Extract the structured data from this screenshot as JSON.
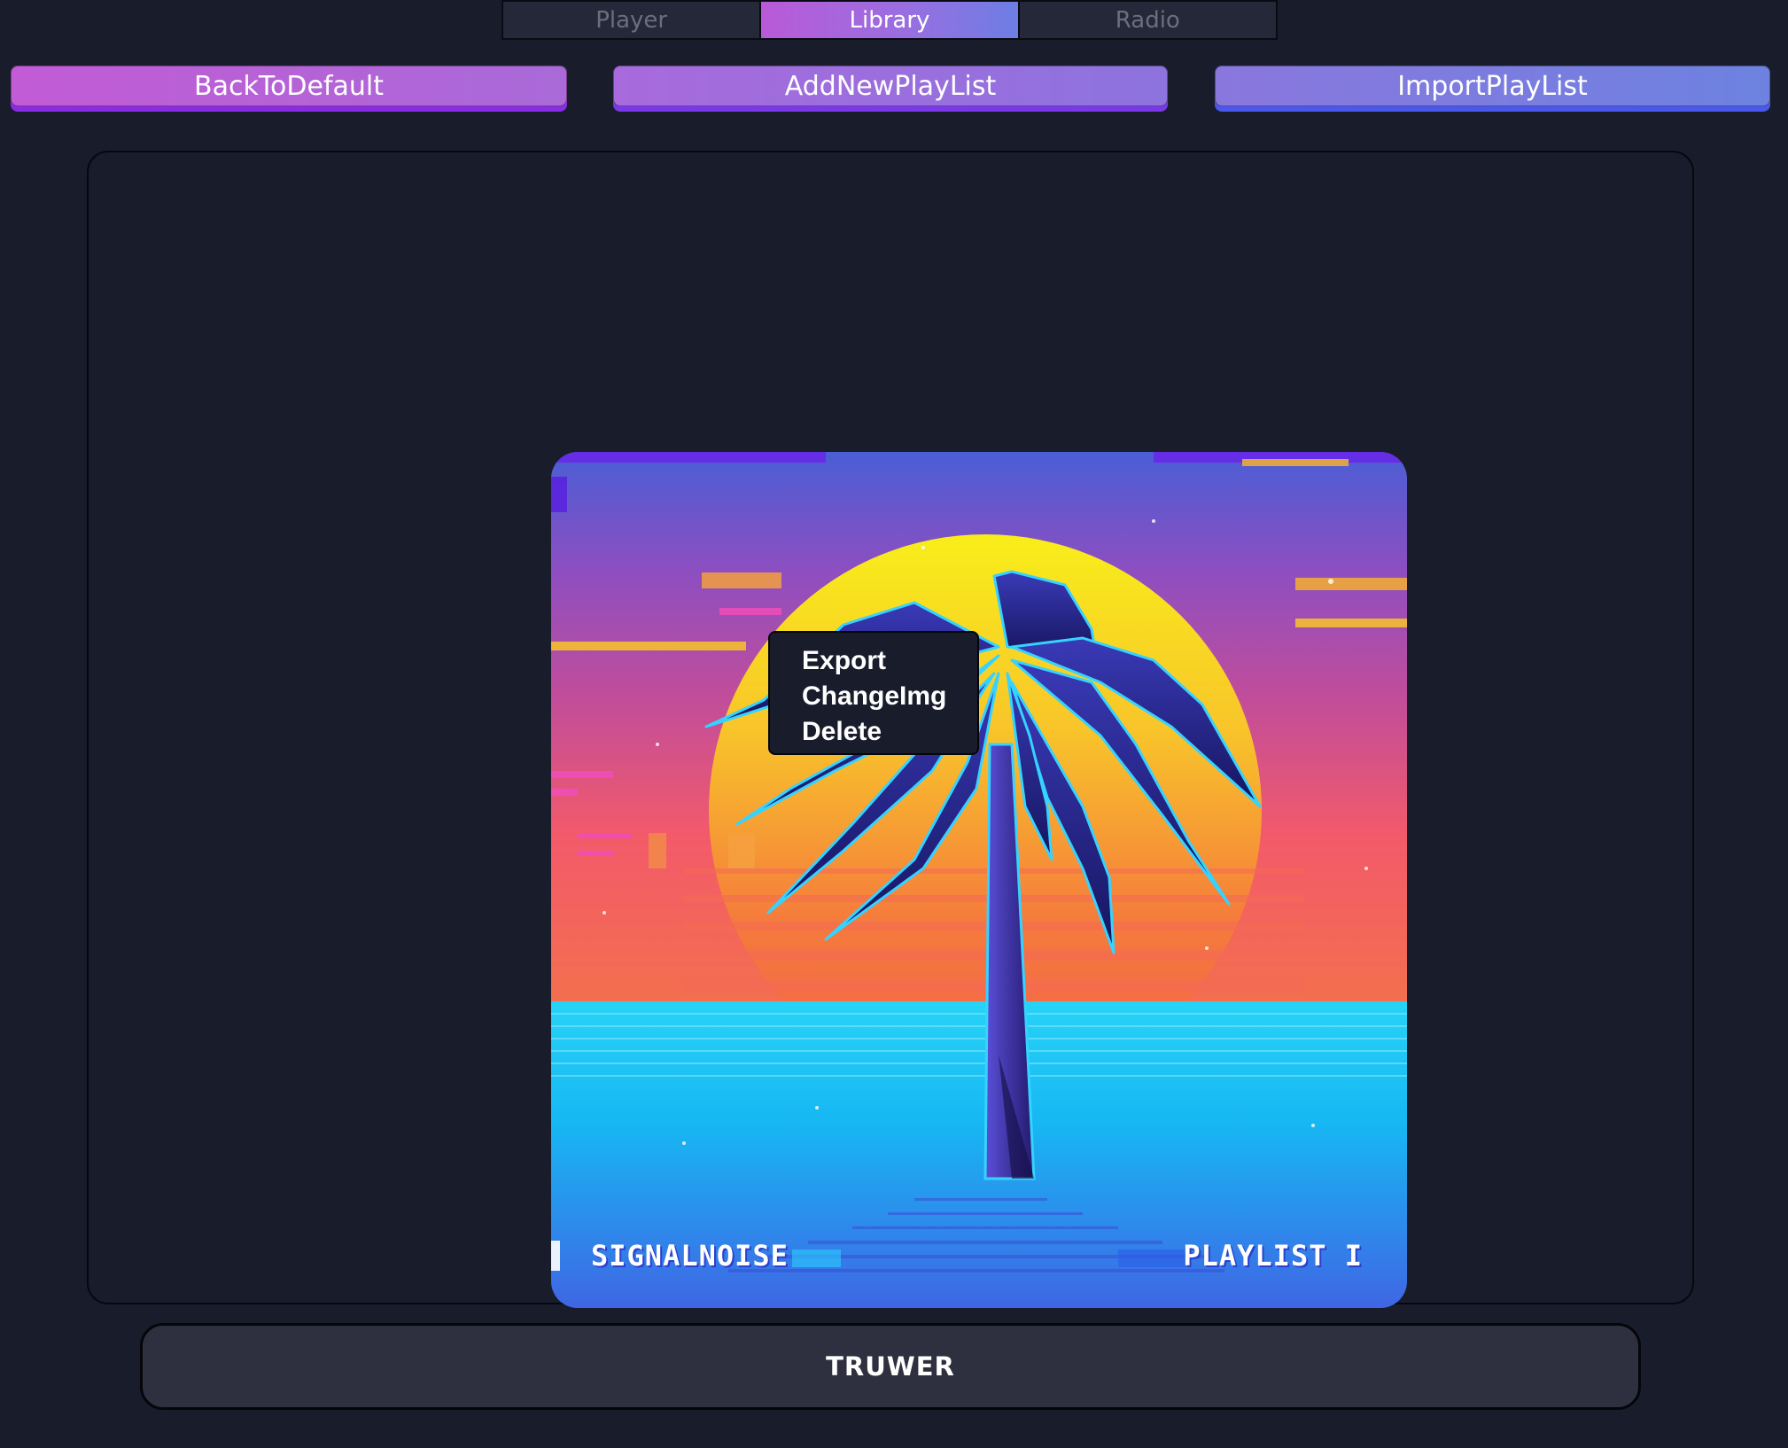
{
  "tabs": [
    {
      "label": "Player",
      "active": false
    },
    {
      "label": "Library",
      "active": true
    },
    {
      "label": "Radio",
      "active": false
    }
  ],
  "actions": {
    "back_to_default": "BackToDefault",
    "add_new_playlist": "AddNewPlayList",
    "import_playlist": "ImportPlayList"
  },
  "playlist": {
    "cover_left_text": "SIGNALNOISE",
    "cover_right_text": "PLAYLIST I"
  },
  "context_menu": {
    "items": [
      "Export",
      "ChangeImg",
      "Delete"
    ]
  },
  "footer": {
    "label": "TRUWER"
  },
  "colors": {
    "background": "#191c2b",
    "accent_start": "#c25bd6",
    "accent_end": "#6d82e0"
  }
}
